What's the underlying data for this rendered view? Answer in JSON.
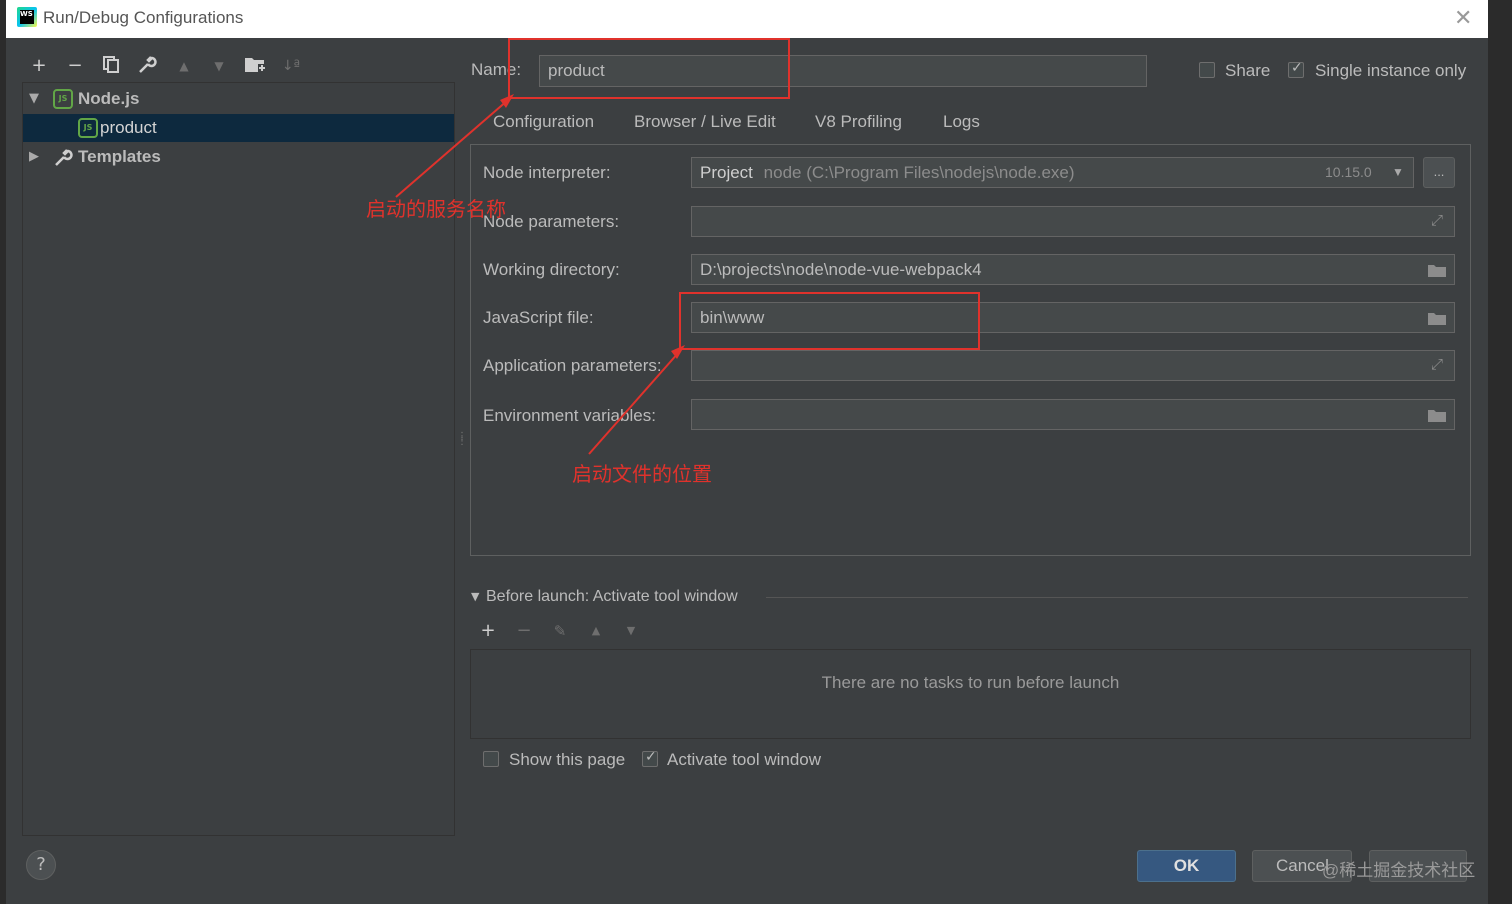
{
  "window": {
    "title": "Run/Debug Configurations",
    "logo_text": "WS"
  },
  "toolbar": {
    "add": "+",
    "remove": "−",
    "copy": "⧉",
    "edit": "🔧",
    "up": "▲",
    "down": "▼",
    "folder": "📁",
    "sort": "↓ª"
  },
  "tree": {
    "group_label": "Node.js",
    "group_icon_text": "JS",
    "item_label": "product",
    "item_icon_text": "JS",
    "templates_label": "Templates"
  },
  "name_row": {
    "label": "Name:",
    "value": "product",
    "share_label": "Share",
    "share_checked": false,
    "single_label": "Single instance only",
    "single_checked": true
  },
  "tabs": [
    "Configuration",
    "Browser / Live Edit",
    "V8 Profiling",
    "Logs"
  ],
  "config": {
    "node_interpreter_label": "Node interpreter:",
    "interpreter_project": "Project",
    "interpreter_path": "node (C:\\Program Files\\nodejs\\node.exe)",
    "interpreter_version": "10.15.0",
    "browse_button": "...",
    "node_parameters_label": "Node parameters:",
    "node_parameters_value": "",
    "working_directory_label": "Working directory:",
    "working_directory_value": "D:\\projects\\node\\node-vue-webpack4",
    "javascript_file_label": "JavaScript file:",
    "javascript_file_value": "bin\\www",
    "application_parameters_label": "Application parameters:",
    "application_parameters_value": "",
    "environment_variables_label": "Environment variables:",
    "environment_variables_value": ""
  },
  "annotations": {
    "service_name": "启动的服务名称",
    "file_location": "启动文件的位置"
  },
  "before_launch": {
    "header": "Before launch: Activate tool window",
    "empty_text": "There are no tasks to run before launch",
    "show_page_label": "Show this page",
    "show_page_checked": false,
    "activate_label": "Activate tool window",
    "activate_checked": true
  },
  "buttons": {
    "help": "?",
    "ok": "OK",
    "cancel": "Cancel",
    "watermark": "@稀土掘金技术社区"
  },
  "colors": {
    "accent": "#365880",
    "annotation": "#e0322c",
    "selection": "#0d293e"
  }
}
